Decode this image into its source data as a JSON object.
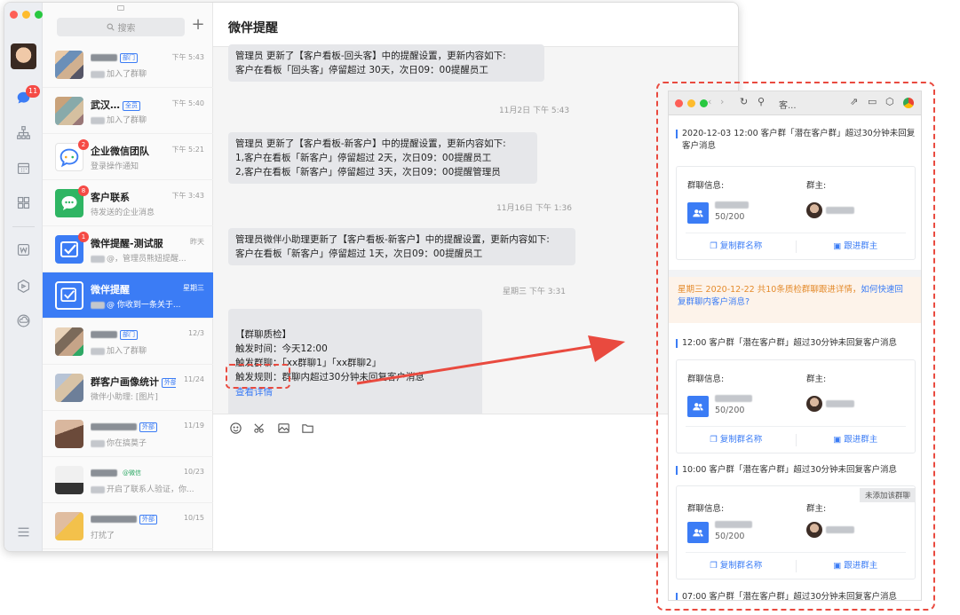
{
  "app": {
    "search_placeholder": "搜索",
    "plus_label": "+",
    "rail_badge": "11"
  },
  "chats": [
    {
      "name": "",
      "tag": "部门",
      "tag_color": "blue",
      "sub": "加入了群聊",
      "time": "下午 5:43",
      "badge": ""
    },
    {
      "name": "武汉…",
      "tag": "全员",
      "tag_color": "blue",
      "sub": "加入了群聊",
      "time": "下午 5:40",
      "badge": ""
    },
    {
      "name": "企业微信团队",
      "tag": "",
      "tag_color": "",
      "sub": "登录操作通知",
      "time": "下午 5:21",
      "badge": "2"
    },
    {
      "name": "客户联系",
      "tag": "",
      "tag_color": "",
      "sub": "待发送的企业消息",
      "time": "下午 3:43",
      "badge": "8"
    },
    {
      "name": "微伴提醒-测试服",
      "tag": "",
      "tag_color": "",
      "sub": "@，管理员熊妞提醒...",
      "time": "昨天",
      "badge": "1"
    },
    {
      "name": "微伴提醒",
      "tag": "",
      "tag_color": "",
      "sub": "@ 你收到一条关于...",
      "time": "星期三",
      "badge": ""
    },
    {
      "name": "",
      "tag": "部门",
      "tag_color": "blue",
      "sub": "加入了群聊",
      "time": "12/3",
      "badge": ""
    },
    {
      "name": "群客户画像统计",
      "tag": "外部",
      "tag_color": "blue",
      "sub": "微伴小助理: [图片]",
      "time": "11/24",
      "badge": ""
    },
    {
      "name": "",
      "tag": "外部",
      "tag_color": "blue",
      "sub": "你在搞莫子",
      "time": "11/19",
      "badge": ""
    },
    {
      "name": "",
      "tag": "@微信",
      "tag_color": "green",
      "sub": "开启了联系人验证，你...",
      "time": "10/23",
      "badge": ""
    },
    {
      "name": "",
      "tag": "外部",
      "tag_color": "blue",
      "sub": "打扰了",
      "time": "10/15",
      "badge": ""
    }
  ],
  "conversation": {
    "title": "微伴提醒",
    "messages": [
      {
        "text": "管理员 更新了【客户看板-回头客】中的提醒设置，更新内容如下:\n客户在看板「回头客」停留超过 30天，次日09：00提醒员工"
      },
      {
        "text": "管理员 更新了【客户看板-新客户】中的提醒设置，更新内容如下:\n1,客户在看板「新客户」停留超过 2天，次日09：00提醒员工\n2,客户在看板「新客户」停留超过 3天，次日09：00提醒管理员"
      },
      {
        "text": "管理员微伴小助理更新了【客户看板-新客户】中的提醒设置，更新内容如下:\n客户在看板「新客户」停留超过 1天，次日09：00提醒员工"
      },
      {
        "text": "【群聊质检】\n触发时间：今天12:00\n触发群聊：「xx群聊1」「xx群聊2」\n触发规则：群聊内超过30分钟未回复客户消息"
      }
    ],
    "stamps": [
      "11月2日 下午 5:43",
      "11月16日 下午 1:36",
      "星期三 下午 3:31"
    ],
    "detail_link": "查看详情"
  },
  "panel": {
    "toolbar_title": "客...",
    "alerts": [
      "2020-12-03 12:00 客户群「潜在客户群」超过30分钟未回复客户消息",
      "12:00 客户群「潜在客户群」超过30分钟未回复客户消息",
      "10:00 客户群「潜在客户群」超过30分钟未回复客户消息",
      "07:00 客户群「潜在客户群」超过30分钟未回复客户消息"
    ],
    "notice_prefix": "星期三 2020-12-22 共10条质检群聊跟进详情，",
    "notice_link": "如何快速回复群聊内客户消息?",
    "group_info_label": "群聊信息:",
    "owner_label": "群主:",
    "member_count": "50/200",
    "copy_label": "复制群名称",
    "follow_label": "跟进群主",
    "not_joined": "未添加该群聊"
  },
  "colors": {
    "accent": "#3b7cf5",
    "alert_red": "#e94a3f",
    "badge_red": "#f54a45",
    "notice_orange": "#e48b2c"
  }
}
